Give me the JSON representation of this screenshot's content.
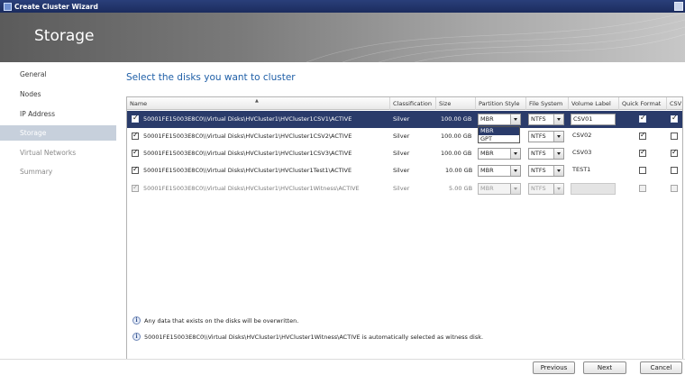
{
  "window": {
    "title": "Create Cluster Wizard"
  },
  "banner": {
    "title": "Storage"
  },
  "sidebar": {
    "items": [
      {
        "label": "General"
      },
      {
        "label": "Nodes"
      },
      {
        "label": "IP Address"
      },
      {
        "label": "Storage"
      },
      {
        "label": "Virtual Networks"
      },
      {
        "label": "Summary"
      }
    ]
  },
  "main": {
    "heading": "Select the disks you want to cluster",
    "columns": [
      "Name",
      "Classification",
      "Size",
      "Partition Style",
      "File System",
      "Volume Label",
      "Quick Format",
      "CSV"
    ],
    "rows": [
      {
        "selected": true,
        "name": "50001FE15003E8C0\\\\Virtual Disks\\HVCluster1\\HVCluster1CSV1\\ACTIVE",
        "classification": "Silver",
        "size": "100.00 GB",
        "partition": "MBR",
        "filesystem": "NTFS",
        "volume_label": "CSV01",
        "quick_format": true,
        "csv": true
      },
      {
        "selected": true,
        "name": "50001FE15003E8C0\\\\Virtual Disks\\HVCluster1\\HVCluster1CSV2\\ACTIVE",
        "classification": "Silver",
        "size": "100.00 GB",
        "partition": "",
        "filesystem": "NTFS",
        "volume_label": "CSV02",
        "quick_format": true,
        "csv": false
      },
      {
        "selected": true,
        "name": "50001FE15003E8C0\\\\Virtual Disks\\HVCluster1\\HVCluster1CSV3\\ACTIVE",
        "classification": "Silver",
        "size": "100.00 GB",
        "partition": "MBR",
        "filesystem": "NTFS",
        "volume_label": "CSV03",
        "quick_format": true,
        "csv": true
      },
      {
        "selected": true,
        "name": "50001FE15003E8C0\\\\Virtual Disks\\HVCluster1\\HVCluster1Test1\\ACTIVE",
        "classification": "Silver",
        "size": "10.00 GB",
        "partition": "MBR",
        "filesystem": "NTFS",
        "volume_label": "TEST1",
        "quick_format": false,
        "csv": false
      },
      {
        "selected": true,
        "name": "50001FE15003E8C0\\\\Virtual Disks\\HVCluster1\\HVCluster1Witness\\ACTIVE",
        "classification": "Silver",
        "size": "5.00 GB",
        "partition": "MBR",
        "filesystem": "NTFS",
        "volume_label": "",
        "quick_format": false,
        "csv": false
      }
    ],
    "partition_options": [
      "MBR",
      "GPT"
    ],
    "notes": [
      "Any data that exists on the disks will be overwritten.",
      "50001FE15003E8C0\\\\Virtual Disks\\HVCluster1\\HVCluster1Witness\\ACTIVE is automatically selected as witness disk."
    ]
  },
  "footer": {
    "previous_label": "Previous",
    "next_label": "Next",
    "cancel_label": "Cancel"
  }
}
